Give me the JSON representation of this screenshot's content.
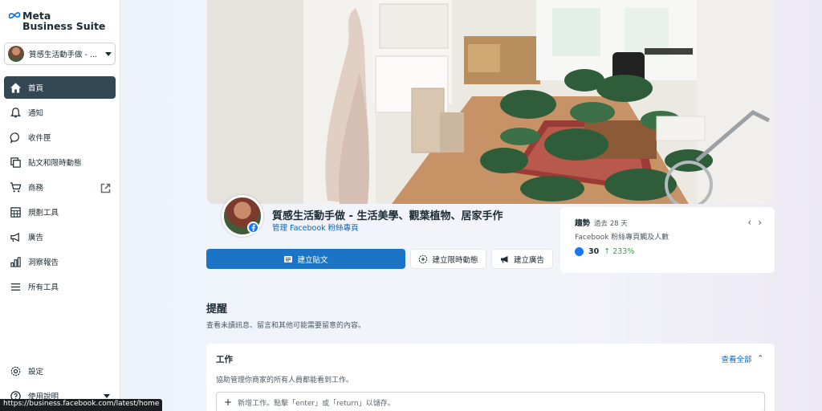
{
  "brand": {
    "line1": "Meta",
    "line2": "Business Suite"
  },
  "account": {
    "name": "質感生活動手做 - ..."
  },
  "nav": [
    {
      "label": "首頁",
      "icon": "home-icon",
      "active": true
    },
    {
      "label": "通知",
      "icon": "bell-icon"
    },
    {
      "label": "收件匣",
      "icon": "chat-bubble-icon"
    },
    {
      "label": "貼文和限時動態",
      "icon": "posts-icon"
    },
    {
      "label": "商務",
      "icon": "cart-icon",
      "external": true
    },
    {
      "label": "規劃工具",
      "icon": "calendar-grid-icon"
    },
    {
      "label": "廣告",
      "icon": "megaphone-icon"
    },
    {
      "label": "洞察報告",
      "icon": "bar-chart-icon"
    },
    {
      "label": "所有工具",
      "icon": "menu-icon"
    }
  ],
  "bottom_nav": [
    {
      "label": "設定",
      "icon": "gear-icon"
    },
    {
      "label": "使用說明",
      "icon": "help-icon"
    }
  ],
  "page": {
    "title": "質感生活動手做 - 生活美學、觀葉植物、居家手作",
    "subtitle": "管理 Facebook 粉絲專頁"
  },
  "actions": {
    "create_post": "建立貼文",
    "create_story": "建立限時動態",
    "create_ad": "建立廣告"
  },
  "trends": {
    "title": "趨勢",
    "period": "過去 28 天",
    "metric": "Facebook 粉絲專頁觸及人數",
    "value": "30",
    "change": "233%"
  },
  "reminders": {
    "title": "提醒",
    "description": "查看未讀訊息、留言和其他可能需要留意的內容。"
  },
  "tasks": {
    "title": "工作",
    "view_all": "查看全部",
    "description": "協助管理你商家的所有人員都能看到工作。",
    "input_placeholder": "新增工作。點擊「enter」或「return」以儲存。"
  },
  "status_url": "https://business.facebook.com/latest/home",
  "colors": {
    "primary": "#1b74c5",
    "nav_active": "#344854",
    "facebook": "#1877f2",
    "positive": "#31a24c"
  }
}
